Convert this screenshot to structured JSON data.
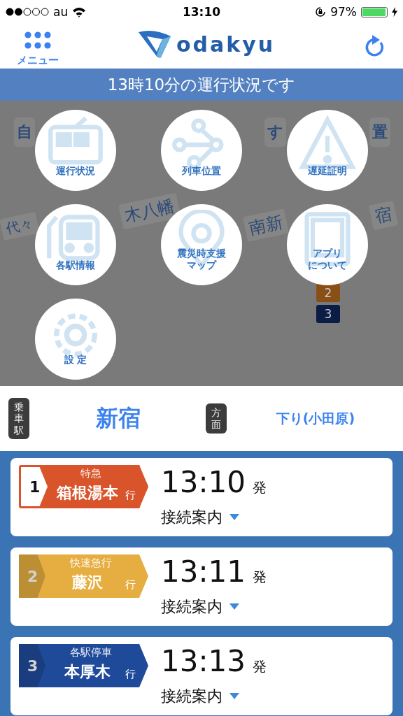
{
  "status_bar": {
    "carrier": "au",
    "time": "13:10",
    "battery": "97%"
  },
  "header": {
    "menu_label": "メニュー",
    "logo_text": "odakyu"
  },
  "banner": "13時10分の運行状況です",
  "map_labels": [
    {
      "text": "自"
    },
    {
      "text": "す"
    },
    {
      "text": "置"
    },
    {
      "text": "代々"
    },
    {
      "text": "木八幡"
    },
    {
      "text": "南新"
    },
    {
      "text": "宿"
    },
    {
      "text": "2"
    },
    {
      "text": "3"
    }
  ],
  "menu": [
    {
      "lines": [
        "運行状況"
      ],
      "kind": "train"
    },
    {
      "lines": [
        "列車位置"
      ],
      "kind": "route"
    },
    {
      "lines": [
        "遅延証明"
      ],
      "kind": "warning"
    },
    {
      "lines": [
        "各駅情報"
      ],
      "kind": "station"
    },
    {
      "lines": [
        "震災時支援",
        "マップ"
      ],
      "kind": "pin"
    },
    {
      "lines": [
        "アプリ",
        "について"
      ],
      "kind": "tablet"
    },
    {
      "lines": [
        "設 定"
      ],
      "kind": "gear"
    }
  ],
  "station": {
    "label": "乗車駅",
    "name": "新宿",
    "direction_label": "方面",
    "direction": "下り(小田原)"
  },
  "trains": [
    {
      "number": "1",
      "type": "特急",
      "destination": "箱根湯本",
      "suffix": "行",
      "time": "13:10",
      "depart": "発",
      "connection": "接続案内",
      "color": "#d9542a",
      "kind": "outlined"
    },
    {
      "number": "2",
      "type": "快速急行",
      "destination": "藤沢",
      "suffix": "行",
      "time": "13:11",
      "depart": "発",
      "connection": "接続案内",
      "color": "#e6ae40",
      "kind": "solid"
    },
    {
      "number": "3",
      "type": "各駅停車",
      "destination": "本厚木",
      "suffix": "行",
      "time": "13:13",
      "depart": "発",
      "connection": "接続案内",
      "color": "#1f4a9a",
      "kind": "solid"
    }
  ]
}
